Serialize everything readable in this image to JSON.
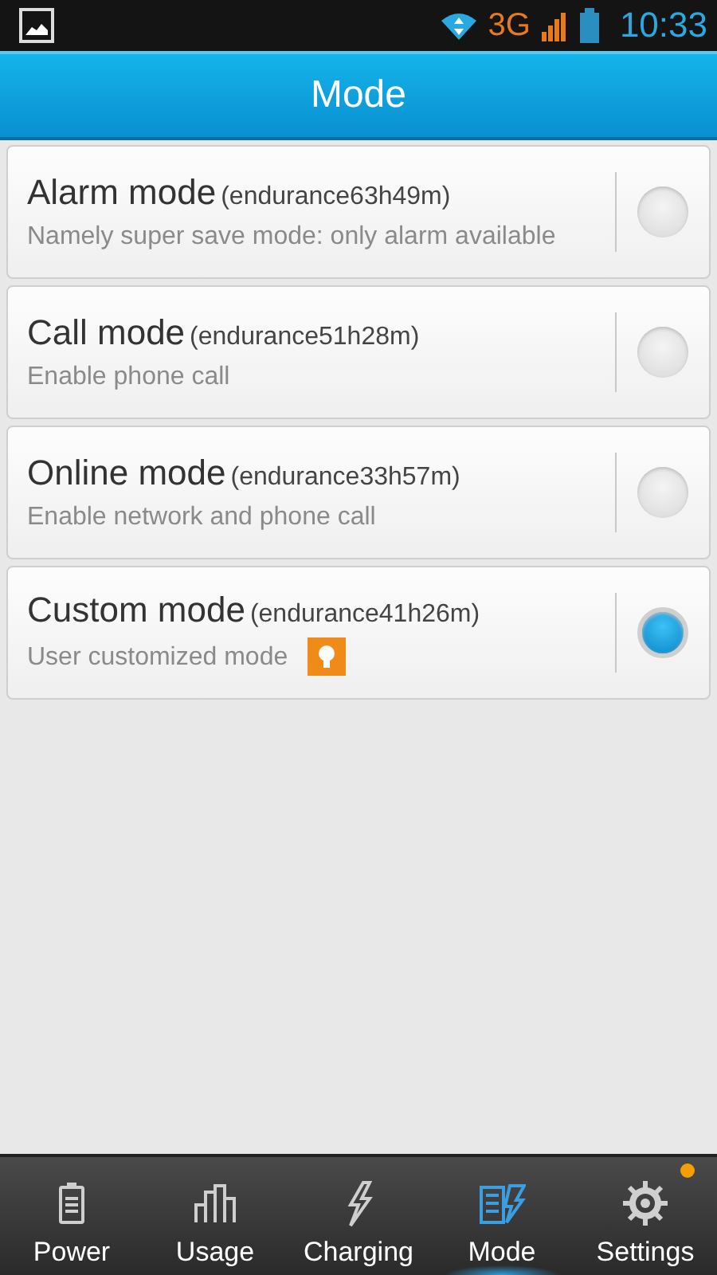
{
  "status_bar": {
    "network": "3G",
    "time": "10:33"
  },
  "title": "Mode",
  "modes": [
    {
      "name": "Alarm mode",
      "endurance": "(endurance63h49m)",
      "description": "Namely super save mode: only alarm available",
      "tip": false,
      "selected": false
    },
    {
      "name": "Call mode",
      "endurance": "(endurance51h28m)",
      "description": "Enable phone call",
      "tip": false,
      "selected": false
    },
    {
      "name": "Online mode",
      "endurance": "(endurance33h57m)",
      "description": "Enable network and phone call",
      "tip": false,
      "selected": false
    },
    {
      "name": "Custom mode",
      "endurance": "(endurance41h26m)",
      "description": "User customized mode",
      "tip": true,
      "selected": true
    }
  ],
  "nav": [
    {
      "kind": "power",
      "label": "Power",
      "selected": false,
      "notification": false
    },
    {
      "kind": "usage",
      "label": "Usage",
      "selected": false,
      "notification": false
    },
    {
      "kind": "charging",
      "label": "Charging",
      "selected": false,
      "notification": false
    },
    {
      "kind": "mode",
      "label": "Mode",
      "selected": true,
      "notification": false
    },
    {
      "kind": "settings",
      "label": "Settings",
      "selected": false,
      "notification": true
    }
  ]
}
